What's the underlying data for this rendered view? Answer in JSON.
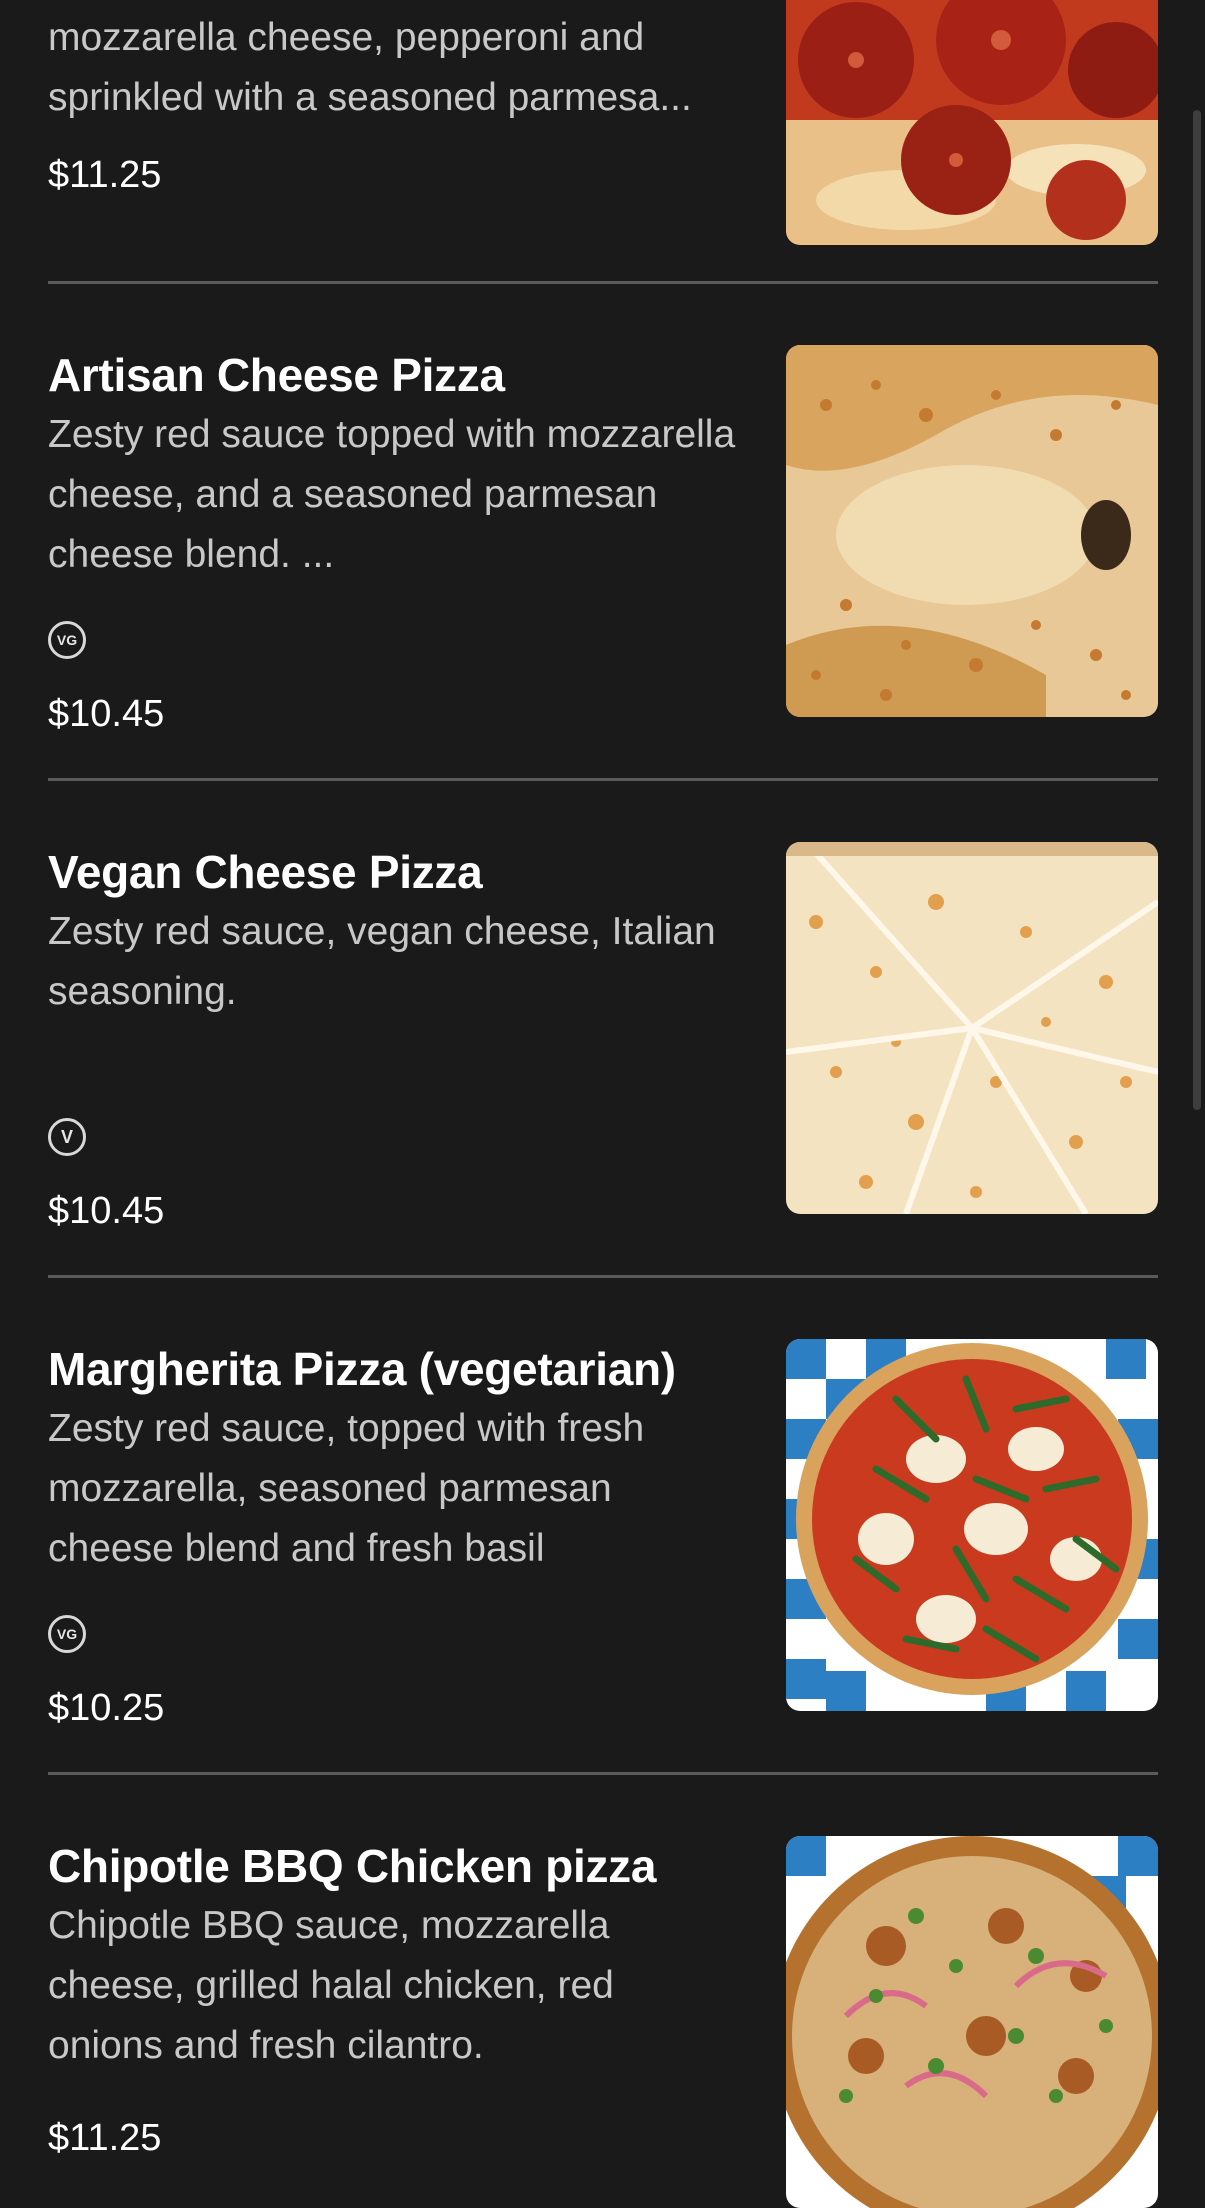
{
  "menu": {
    "items": [
      {
        "name": "",
        "description_line1": "mozzarella cheese, pepperoni and",
        "description_line2": "sprinkled with a seasoned parmesa...",
        "price": "$11.25",
        "image": "pepperoni-pizza-photo"
      },
      {
        "name": "Artisan Cheese Pizza",
        "description": " Zesty red sauce topped with mozzarella cheese, and a seasoned parmesan cheese blend. ...",
        "badge": "VG",
        "price": "$10.45",
        "image": "cheese-pizza-photo"
      },
      {
        "name": "Vegan Cheese Pizza",
        "description": "Zesty red sauce, vegan cheese, Italian seasoning.",
        "badge": "V",
        "price": "$10.45",
        "image": "vegan-cheese-pizza-photo"
      },
      {
        "name": "Margherita Pizza (vegetarian)",
        "description": "Zesty red sauce, topped with fresh mozzarella, seasoned parmesan cheese blend and fresh basil",
        "badge": "VG",
        "price": "$10.25",
        "image": "margherita-pizza-photo"
      },
      {
        "name": "Chipotle BBQ Chicken pizza",
        "description": "Chipotle BBQ sauce, mozzarella cheese, grilled halal chicken, red onions and fresh cilantro.",
        "price": "$11.25",
        "image": "bbq-chicken-pizza-photo"
      }
    ]
  },
  "colors": {
    "background": "#1a1a1a",
    "text": "#ffffff",
    "description": "#c8c8c8",
    "divider": "#5a5a5a"
  }
}
